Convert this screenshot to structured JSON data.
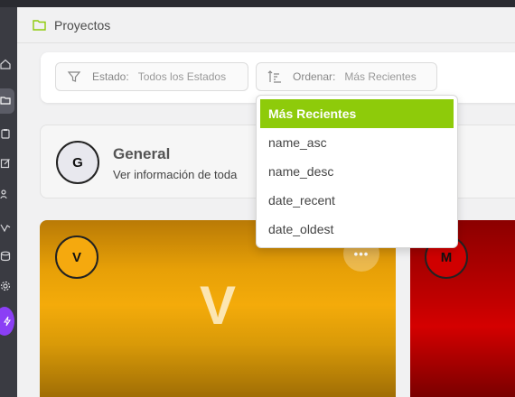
{
  "header": {
    "title": "Proyectos",
    "icon": "folder-icon"
  },
  "sidebar": {
    "icons": [
      "home-icon",
      "folder-icon",
      "clipboard-icon",
      "edit-icon",
      "users-icon",
      "chart-icon",
      "database-icon",
      "gear-icon",
      "bolt-icon"
    ]
  },
  "filters": {
    "estado": {
      "label": "Estado:",
      "value": "Todos los Estados"
    },
    "ordenar": {
      "label": "Ordenar:",
      "value": "Más Recientes"
    }
  },
  "sort_dropdown": {
    "options": [
      "Más Recientes",
      "name_asc",
      "name_desc",
      "date_recent",
      "date_oldest"
    ],
    "selected": "Más Recientes"
  },
  "general_card": {
    "avatar": "G",
    "title": "General",
    "description": "Ver información de toda"
  },
  "projects": [
    {
      "avatar": "V",
      "letter": "V",
      "more": "•••",
      "color": "#f4ab0a"
    },
    {
      "avatar": "M",
      "color": "#c00000"
    }
  ],
  "colors": {
    "accent": "#8ecb0a",
    "bolt": "#8b3ff5",
    "sidebar": "#3a3b42"
  }
}
